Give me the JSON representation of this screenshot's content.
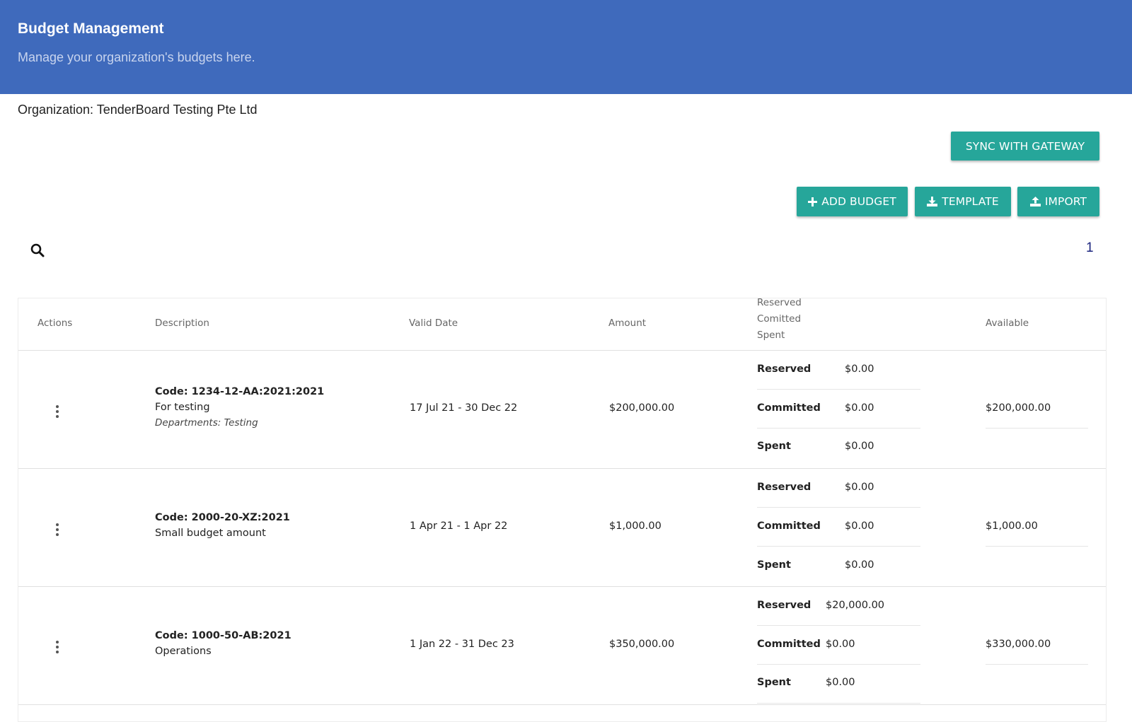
{
  "header": {
    "title": "Budget Management",
    "subtitle": "Manage your organization's budgets here."
  },
  "organization": "Organization: TenderBoard Testing Pte Ltd",
  "toolbar": {
    "sync_label": "SYNC WITH GATEWAY",
    "add_label": "ADD BUDGET",
    "template_label": "TEMPLATE",
    "import_label": "IMPORT"
  },
  "pagination": {
    "current_page": "1"
  },
  "table": {
    "headers": {
      "actions": "Actions",
      "description": "Description",
      "valid_date": "Valid Date",
      "amount": "Amount",
      "status_lines": [
        "Reserved",
        "Comitted",
        "Spent"
      ],
      "available": "Available"
    },
    "rows": [
      {
        "code": "Code: 1234-12-AA:2021:2021",
        "description": "For testing",
        "departments": "Departments: Testing",
        "valid_date": "17 Jul 21 - 30 Dec 22",
        "amount": "$200,000.00",
        "reserved_label": "Reserved",
        "reserved": "$0.00",
        "committed_label": "Committed",
        "committed": "$0.00",
        "spent_label": "Spent",
        "spent": "$0.00",
        "available": "$200,000.00"
      },
      {
        "code": "Code: 2000-20-XZ:2021",
        "description": "Small budget amount",
        "valid_date": "1 Apr 21 - 1 Apr 22",
        "amount": "$1,000.00",
        "reserved_label": "Reserved",
        "reserved": "$0.00",
        "committed_label": "Committed",
        "committed": "$0.00",
        "spent_label": "Spent",
        "spent": "$0.00",
        "available": "$1,000.00"
      },
      {
        "code": "Code: 1000-50-AB:2021",
        "description": "Operations",
        "valid_date": "1 Jan 22 - 31 Dec 23",
        "amount": "$350,000.00",
        "reserved_label": "Reserved",
        "reserved": "$20,000.00",
        "committed_label": "Committed",
        "committed": "$0.00",
        "spent_label": "Spent",
        "spent": "$0.00",
        "available": "$330,000.00"
      }
    ]
  }
}
